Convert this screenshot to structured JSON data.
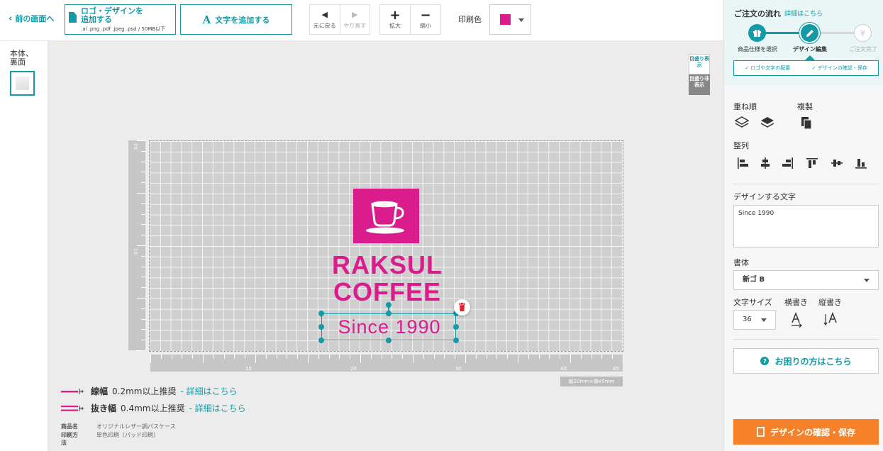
{
  "toolbar": {
    "back_label": "前の画面へ",
    "logo_button_label": "ロゴ・デザインを\n追加する",
    "logo_button_sub": ".ai .png .pdf .jpeg .psd / 50MB以下",
    "text_button_icon": "A",
    "text_button_label": "文字を追加する",
    "undo_label": "元に戻る",
    "redo_label": "やり直す",
    "zoom_in_label": "拡大",
    "zoom_out_label": "縮小",
    "print_color_label": "印刷色",
    "print_color": "#da1c8c"
  },
  "left_panel": {
    "side_label": "本体、\n裏面"
  },
  "canvas": {
    "ruler_toggle_on": "目盛り表示",
    "ruler_toggle_off": "目盛り非表示",
    "vertical_ruler_labels": [
      "20",
      "10"
    ],
    "horizontal_ruler_labels": [
      "10",
      "20",
      "30",
      "40",
      "45"
    ],
    "size_tag": "縦20mm×横45mm",
    "brand_line_1": "RAKSUL",
    "brand_line_2": "COFFEE",
    "selected_text": "Since 1990",
    "brand_color": "#da1c8c",
    "selection_color": "#139aa4"
  },
  "guides": {
    "line_width_title": "線幅",
    "line_width_desc": "0.2mm以上推奨",
    "knockout_title": "抜き幅",
    "knockout_desc": "0.4mm以上推奨",
    "detail_link": "- 詳細はこちら"
  },
  "product_info": {
    "name_key": "商品名",
    "name_value": "オリジナルレザー調パスケース",
    "method_key": "印刷方法",
    "method_value": "単色印刷（パッド印刷）"
  },
  "right_panel": {
    "flow_title": "ご注文の流れ",
    "flow_link": "詳細はこちら",
    "steps": [
      {
        "label": "商品仕様を選択",
        "icon": "gift-icon",
        "state": "done"
      },
      {
        "label": "デザイン編集",
        "icon": "pencil-icon",
        "state": "current"
      },
      {
        "label": "ご注文完了",
        "icon": "yen-icon",
        "state": "todo"
      }
    ],
    "substep_1": "✓ ロゴや文字の配置",
    "substep_2": "✓ デザインの確認・保存",
    "layer_order_label": "重ね順",
    "duplicate_label": "複製",
    "align_label": "整列",
    "design_text_label": "デザインする文字",
    "design_text_value": "Since 1990",
    "font_label": "書体",
    "font_value": "新ゴ B",
    "text_size_label": "文字サイズ",
    "text_size_value": "36",
    "horizontal_label": "横書き",
    "vertical_label": "縦書き",
    "help_button": "お困りの方はこちら",
    "confirm_button": "デザインの確認・保存",
    "accent_color": "#139aa4",
    "cta_color": "#f5822a"
  }
}
